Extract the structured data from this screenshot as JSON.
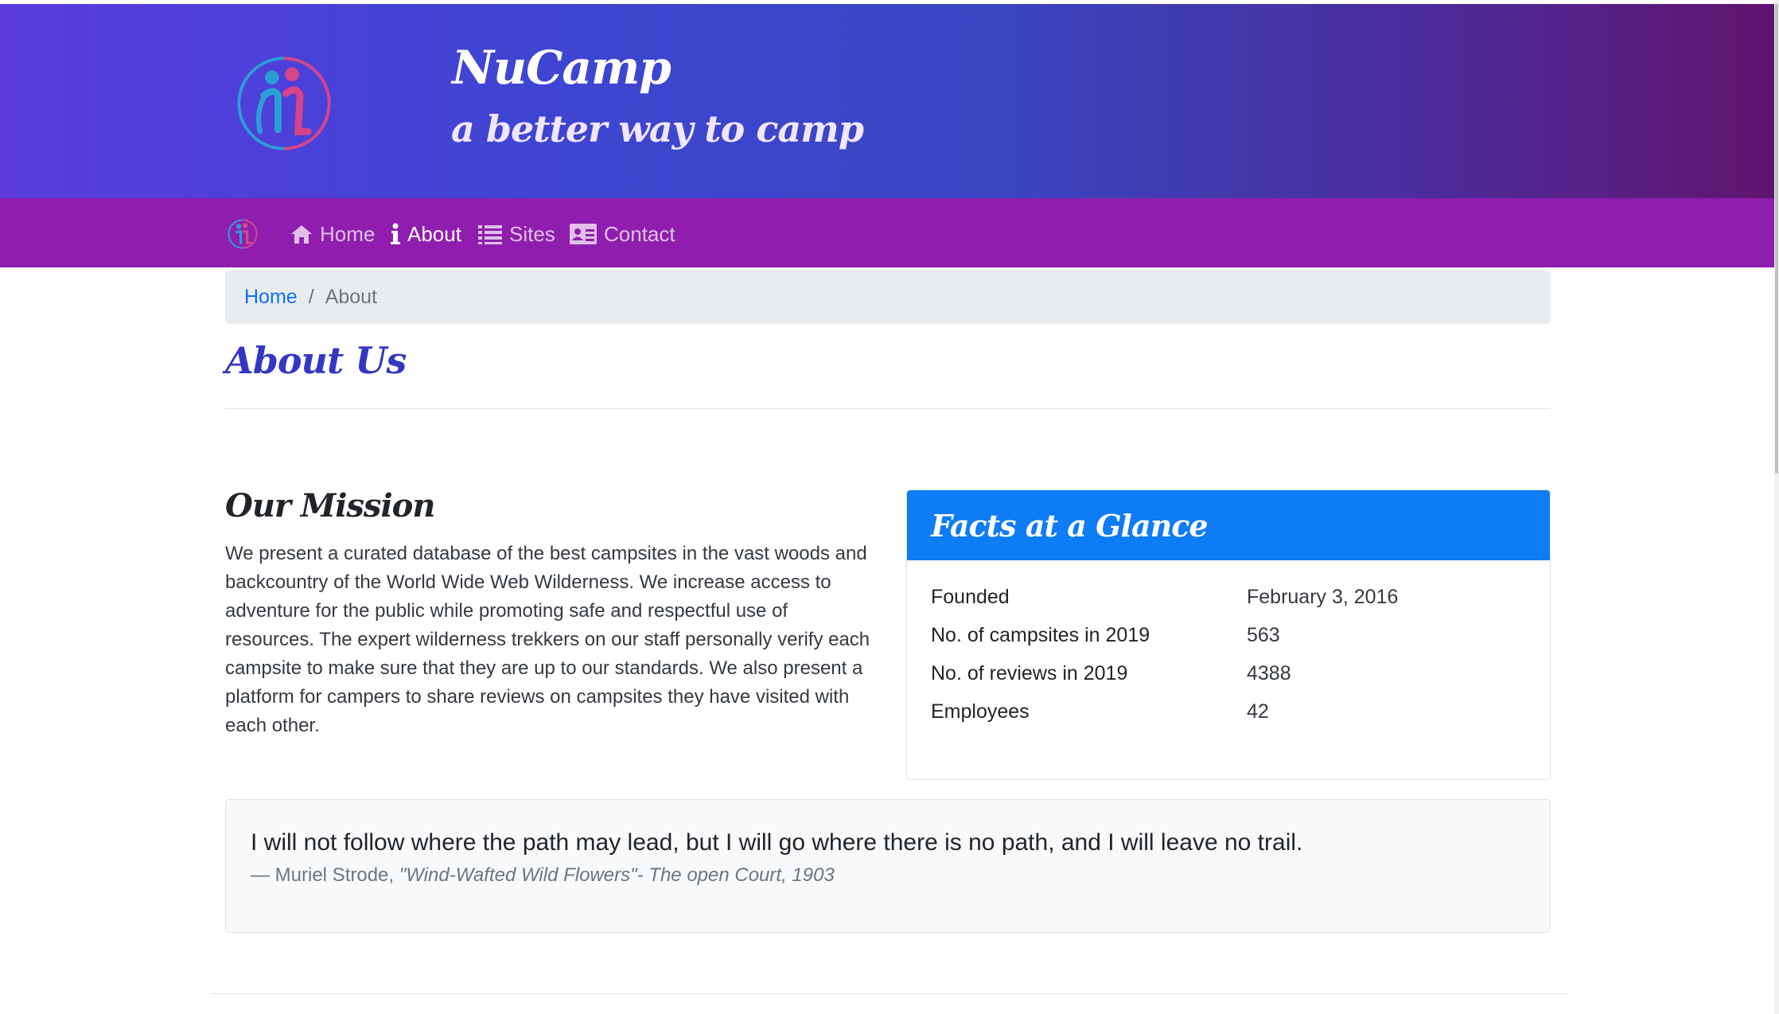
{
  "header": {
    "brand_title": "NuCamp",
    "brand_subtitle": "a better way to camp"
  },
  "nav": {
    "items": [
      {
        "label": "Home",
        "icon": "home-icon",
        "active": false
      },
      {
        "label": "About",
        "icon": "info-icon",
        "active": true
      },
      {
        "label": "Sites",
        "icon": "list-icon",
        "active": false
      },
      {
        "label": "Contact",
        "icon": "address-card-icon",
        "active": false
      }
    ]
  },
  "breadcrumb": {
    "home": "Home",
    "separator": "/",
    "current": "About"
  },
  "page": {
    "title": "About Us"
  },
  "mission": {
    "title": "Our Mission",
    "text": "We present a curated database of the best campsites in the vast woods and backcountry of the World Wide Web Wilderness. We increase access to adventure for the public while promoting safe and respectful use of resources. The expert wilderness trekkers on our staff personally verify each campsite to make sure that they are up to our standards. We also present a platform for campers to share reviews on campsites they have visited with each other."
  },
  "facts": {
    "title": "Facts at a Glance",
    "rows": [
      {
        "label": "Founded",
        "value": "February 3, 2016"
      },
      {
        "label": "No. of campsites in 2019",
        "value": "563"
      },
      {
        "label": "No. of reviews in 2019",
        "value": "4388"
      },
      {
        "label": "Employees",
        "value": "42"
      }
    ]
  },
  "quote": {
    "text": "I will not follow where the path may lead, but I will go where there is no path, and I will leave no trail.",
    "author": "— Muriel Strode,",
    "source": "\"Wind-Wafted Wild Flowers\"- The open Court, 1903"
  },
  "colors": {
    "header_gradient_start": "#5a3be0",
    "header_gradient_end": "#61146e",
    "navbar": "#8f1eae",
    "page_title": "#3436c4",
    "card_header": "#0d7cf5",
    "link": "#0d6efd"
  }
}
